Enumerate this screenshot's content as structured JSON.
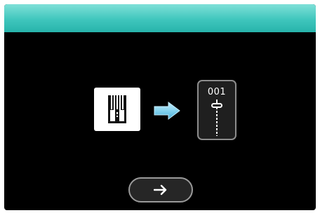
{
  "screen": {
    "header_color": "#3fc6bd",
    "background_color": "#000000"
  },
  "instruction": {
    "source_icon": "presser-foot-icon",
    "transition_icon": "arrow-right-icon",
    "transition_color": "#7fd0ee",
    "stitch_card": {
      "stitch_number": "001",
      "stitch_icon": "straight-stitch-icon"
    }
  },
  "controls": {
    "next_button_icon": "arrow-right-icon"
  }
}
